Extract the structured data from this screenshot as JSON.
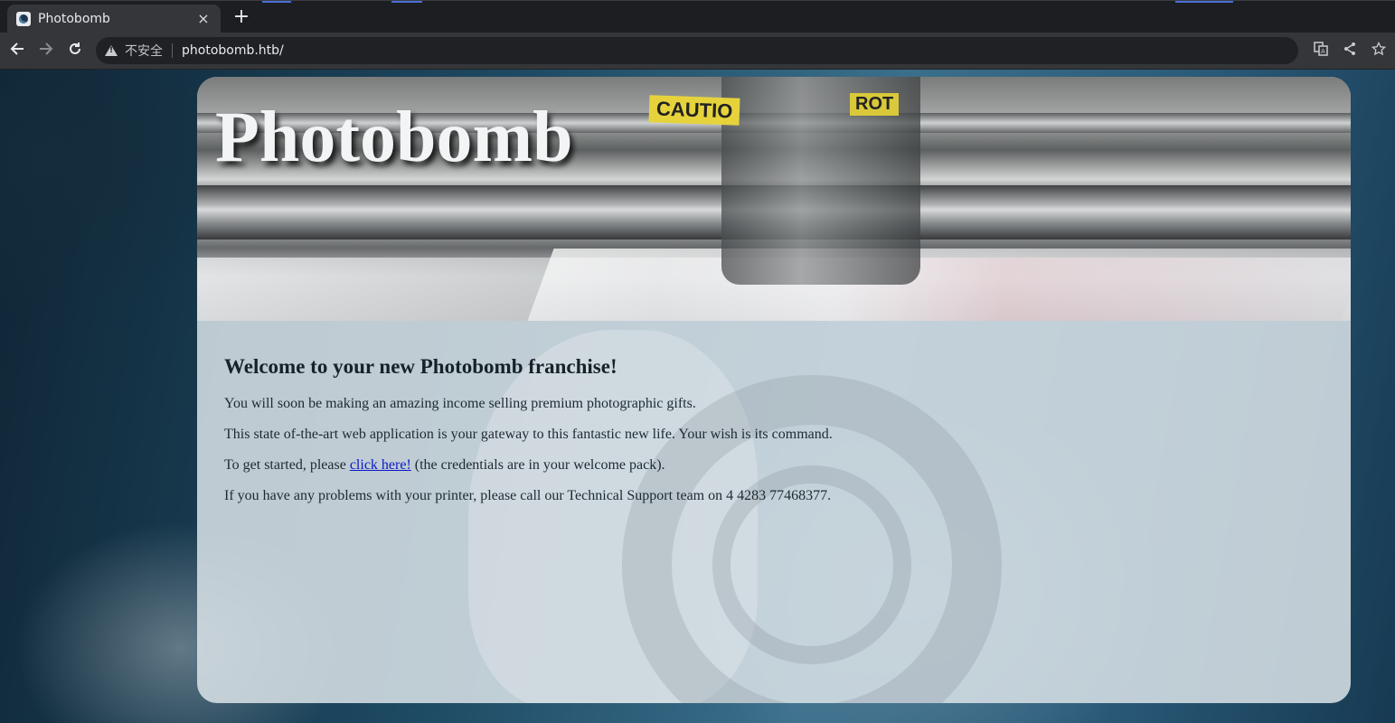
{
  "browser": {
    "tab_title": "Photobomb",
    "tab_close": "×",
    "new_tab": "+",
    "security_label": "不安全",
    "url": "photobomb.htb/"
  },
  "page": {
    "site_title": "Photobomb",
    "header_signs": [
      "CAUTIO",
      "ROT"
    ],
    "heading": "Welcome to your new Photobomb franchise!",
    "para1": "You will soon be making an amazing income selling premium photographic gifts.",
    "para2": "This state of-the-art web application is your gateway to this fantastic new life. Your wish is its command.",
    "para3_before": "To get started, please ",
    "para3_link": "click here!",
    "para3_after": " (the credentials are in your welcome pack).",
    "para4": "If you have any problems with your printer, please call our Technical Support team on 4 4283 77468377."
  },
  "colors": {
    "link": "#0b18c9",
    "chrome_bg": "#35363a"
  },
  "icons": [
    "favicon-icon",
    "close-icon",
    "plus-icon",
    "back-icon",
    "forward-icon",
    "reload-icon",
    "warning-icon",
    "translate-icon",
    "share-icon",
    "star-icon"
  ]
}
